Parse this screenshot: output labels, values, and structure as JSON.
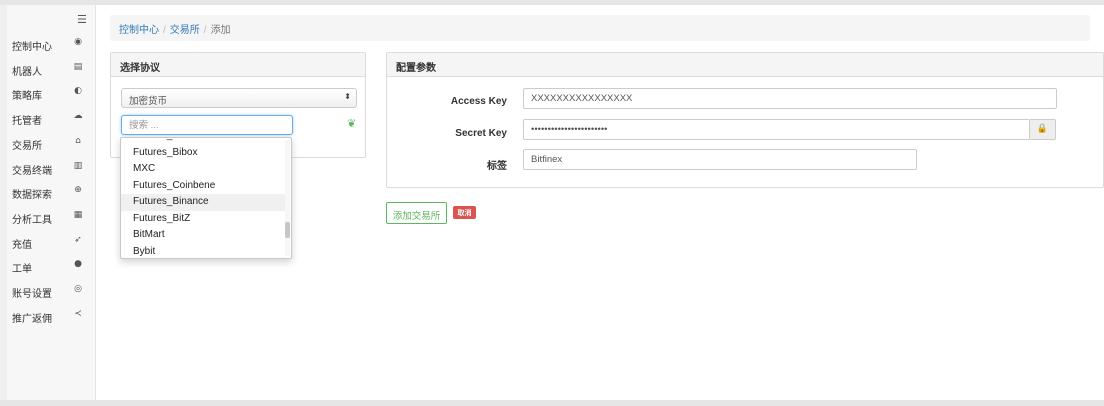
{
  "sidebar": {
    "toggle_icon": "hamburger-icon",
    "items": [
      {
        "label": "控制中心",
        "icon": "dashboard-icon",
        "glyph": "◉"
      },
      {
        "label": "机器人",
        "icon": "robot-list-icon",
        "glyph": "▤"
      },
      {
        "label": "策略库",
        "icon": "strategy-icon",
        "glyph": "◐"
      },
      {
        "label": "托管者",
        "icon": "cloud-icon",
        "glyph": "☁"
      },
      {
        "label": "交易所",
        "icon": "bank-icon",
        "glyph": "⌂"
      },
      {
        "label": "交易终端",
        "icon": "bar-chart-icon",
        "glyph": "▥"
      },
      {
        "label": "数据探索",
        "icon": "search-icon",
        "glyph": "⊕"
      },
      {
        "label": "分析工具",
        "icon": "calculator-icon",
        "glyph": "▦"
      },
      {
        "label": "充值",
        "icon": "rocket-icon",
        "glyph": "➶"
      },
      {
        "label": "工单",
        "icon": "comment-icon",
        "glyph": "●"
      },
      {
        "label": "账号设置",
        "icon": "user-circle-icon",
        "glyph": "◎"
      },
      {
        "label": "推广返佣",
        "icon": "share-icon",
        "glyph": "≺"
      }
    ]
  },
  "breadcrumb": {
    "items": [
      "控制中心",
      "交易所"
    ],
    "current": "添加",
    "separator": "/"
  },
  "protocol_panel": {
    "title": "选择协议",
    "select_value": "加密货币",
    "search_placeholder": "搜索 ...",
    "dropdown_items": [
      "Futures_BFX",
      "Futures_Bibox",
      "MXC",
      "Futures_Coinbene",
      "Futures_Binance",
      "Futures_BitZ",
      "BitMart",
      "Bybit"
    ],
    "highlighted_item": "Futures_Binance"
  },
  "config_panel": {
    "title": "配置参数",
    "access_key_label": "Access Key",
    "access_key_value": "XXXXXXXXXXXXXXXX",
    "secret_key_label": "Secret Key",
    "secret_key_value": "xxxxxxxxxxxxxxxxxxxxxxx",
    "tag_label": "标签",
    "tag_value": "Bitfinex"
  },
  "actions": {
    "add_label": "添加交易所",
    "cancel_label": "取消"
  },
  "colors": {
    "link": "#337ab7",
    "success": "#5cb85c",
    "danger": "#d9534f",
    "focus": "#66afe9"
  }
}
